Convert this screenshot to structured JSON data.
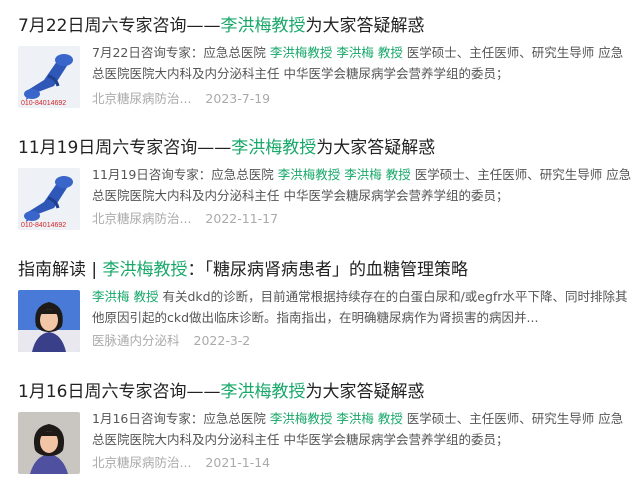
{
  "results": [
    {
      "title_prefix": "7月22日周六专家咨询——",
      "title_highlight": "李洪梅教授",
      "title_suffix": "为大家答疑解惑",
      "snippet_a": "7月22日咨询专家：应急总医院 ",
      "snippet_hl1": "李洪梅教授",
      "snippet_mid": " ",
      "snippet_hl2": "李洪梅 教授",
      "snippet_b": " 医学硕士、主任医师、研究生导师 应急总医院医院大内科及内分泌科主任 中华医学会糖尿病学会营养学组的委员；",
      "source": "北京糖尿病防治...",
      "date": "2023-7-19",
      "thumb_text": "010-84014692"
    },
    {
      "title_prefix": "11月19日周六专家咨询——",
      "title_highlight": "李洪梅教授",
      "title_suffix": "为大家答疑解惑",
      "snippet_a": "11月19日咨询专家：应急总医院 ",
      "snippet_hl1": "李洪梅教授",
      "snippet_mid": " ",
      "snippet_hl2": "李洪梅 教授",
      "snippet_b": " 医学硕士、主任医师、研究生导师 应急总医院医院大内科及内分泌科主任 中华医学会糖尿病学会营养学组的委员；",
      "source": "北京糖尿病防治...",
      "date": "2022-11-17",
      "thumb_text": "010-84014692"
    },
    {
      "title_prefix": "指南解读 | ",
      "title_highlight": "李洪梅教授",
      "title_suffix": "：「糖尿病肾病患者」的血糖管理策略",
      "snippet_a": "",
      "snippet_hl1": "李洪梅 教授",
      "snippet_mid": "",
      "snippet_hl2": "",
      "snippet_b": " 有关dkd的诊断，目前通常根据持续存在的白蛋白尿和/或egfr水平下降、同时排除其他原因引起的ckd做出临床诊断。指南指出，在明确糖尿病作为肾损害的病因并...",
      "source": "医脉通内分泌科",
      "date": "2022-3-2",
      "thumb_text": ""
    },
    {
      "title_prefix": "1月16日周六专家咨询——",
      "title_highlight": "李洪梅教授",
      "title_suffix": "为大家答疑解惑",
      "snippet_a": "1月16日咨询专家：应急总医院 ",
      "snippet_hl1": "李洪梅教授",
      "snippet_mid": " ",
      "snippet_hl2": "李洪梅 教授",
      "snippet_b": " 医学硕士、主任医师、研究生导师 应急总医院医院大内科及内分泌科主任 中华医学会糖尿病学会营养学组的委员；",
      "source": "北京糖尿病防治...",
      "date": "2021-1-14",
      "thumb_text": ""
    }
  ]
}
